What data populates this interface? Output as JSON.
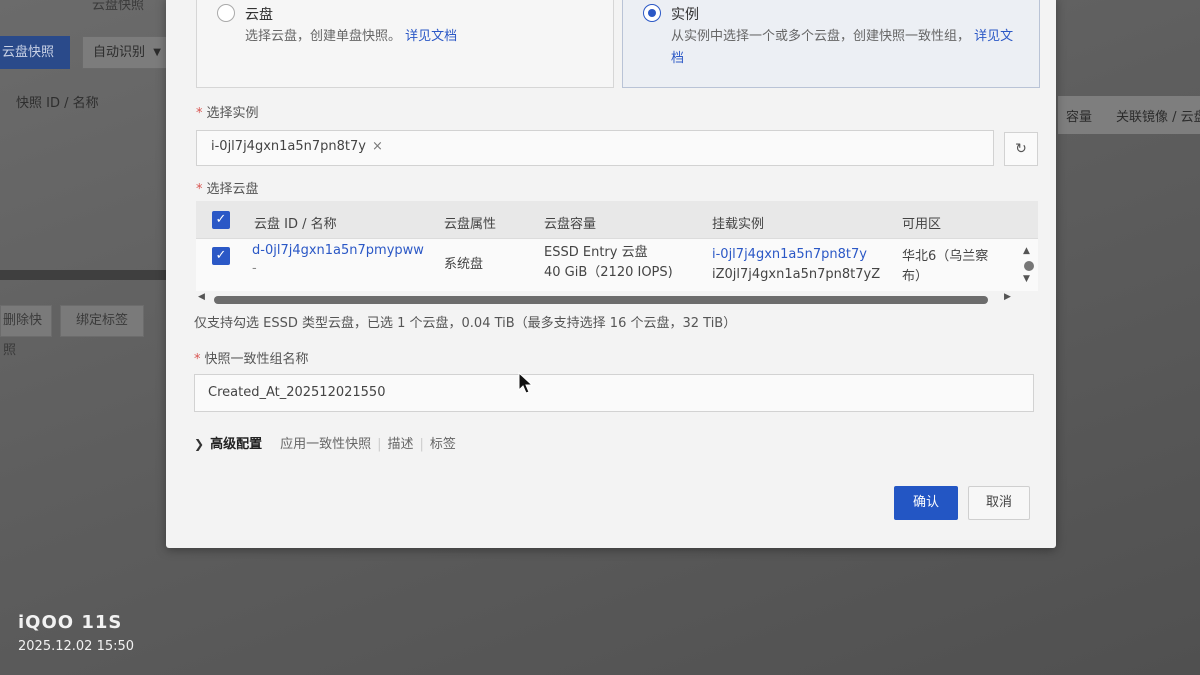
{
  "background": {
    "tabs": [
      "云盘快照"
    ],
    "primary_button": "云盘快照",
    "filter_select": "自动识别",
    "column_head": "快照 ID / 名称",
    "action_buttons": [
      "删除快照",
      "绑定标签"
    ],
    "right_columns": [
      "容量",
      "关联镜像 / 云盘"
    ]
  },
  "dialog": {
    "mode_disk": {
      "title": "云盘",
      "description": "选择云盘，创建单盘快照。",
      "doc_link": "详见文档"
    },
    "mode_instance": {
      "title": "实例",
      "description": "从实例中选择一个或多个云盘，创建快照一致性组，",
      "doc_link": "详见文档",
      "selected": true
    },
    "select_instance": {
      "label": "选择实例",
      "tag": "i-0jl7j4gxn1a5n7pn8t7y",
      "tag_remove": "×"
    },
    "select_disk": {
      "label": "选择云盘",
      "columns": [
        "云盘 ID / 名称",
        "云盘属性",
        "云盘容量",
        "挂载实例",
        "可用区"
      ],
      "rows": [
        {
          "checked": true,
          "disk_id": "d-0jl7j4gxn1a5n7pmypww",
          "disk_name": "-",
          "attribute": "系统盘",
          "capacity_type": "ESSD Entry 云盘",
          "capacity_size": "40 GiB（2120 IOPS)",
          "instance_id": "i-0jl7j4gxn1a5n7pn8t7y",
          "instance_name": "iZ0jl7j4gxn1a5n7pn8t7yZ",
          "zone": "华北6（乌兰察",
          "zone_2": "布）"
        }
      ]
    },
    "hint": "仅支持勾选 ESSD 类型云盘，已选 1 个云盘，0.04 TiB（最多支持选择 16 个云盘，32 TiB）",
    "group_name": {
      "label": "快照一致性组名称",
      "value": "Created_At_202512021550"
    },
    "advanced": {
      "title": "高级配置",
      "items": [
        "应用一致性快照",
        "描述",
        "标签"
      ]
    },
    "confirm_label": "确认",
    "cancel_label": "取消"
  },
  "watermark": {
    "brand": "iQOO 11S",
    "datetime": "2025.12.02 15:50"
  },
  "colors": {
    "primary": "#2356c4",
    "link": "#2b58c6",
    "required": "#d9534f"
  }
}
